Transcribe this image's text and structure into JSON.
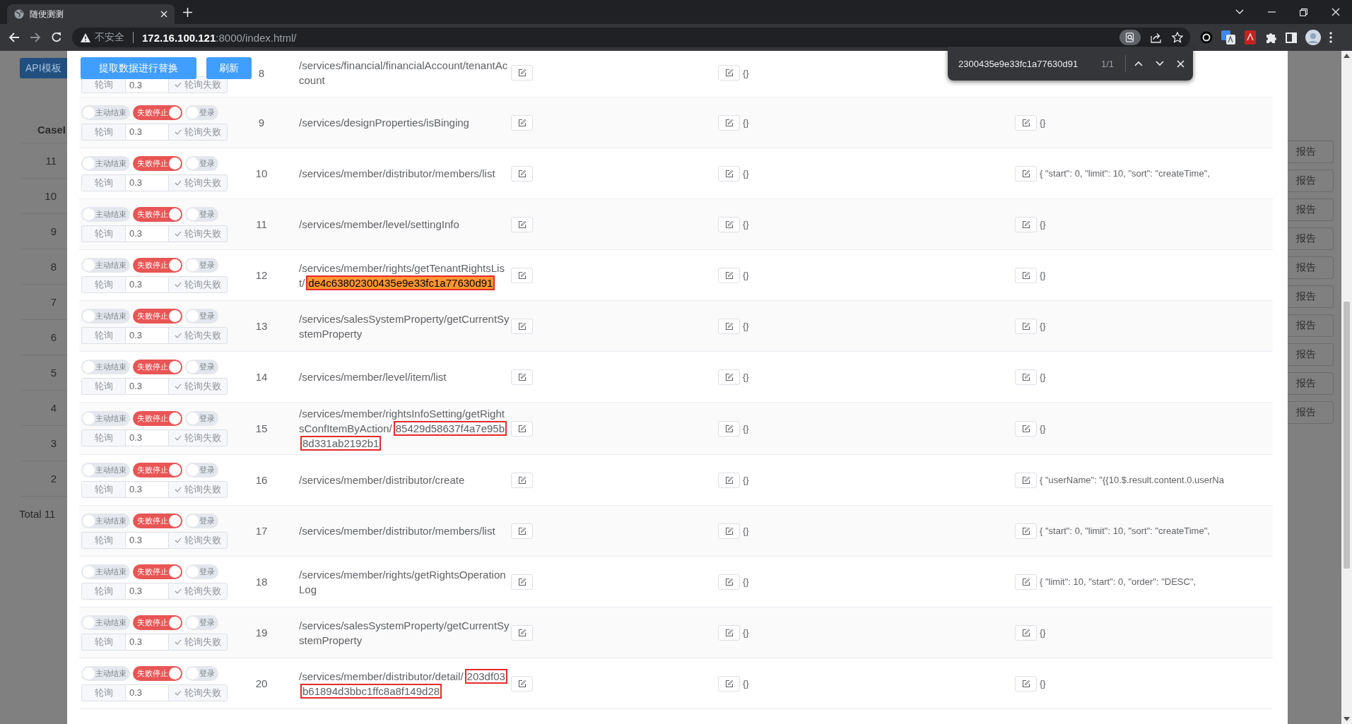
{
  "browser": {
    "tab": {
      "title": "随便测测"
    },
    "address": {
      "security": "不安全",
      "host": "172.16.100.121",
      "rest": ":8000/index.html/"
    }
  },
  "find_bar": {
    "query": "2300435e9e33fc1a77630d91",
    "count": "1/1"
  },
  "background": {
    "button": "API模板",
    "column": "CaseI",
    "case_ids": [
      "11",
      "10",
      "9",
      "8",
      "7",
      "6",
      "5",
      "4",
      "3",
      "2"
    ],
    "report_buttons": [
      "报告",
      "报告",
      "报告",
      "报告",
      "报告",
      "报告",
      "报告",
      "报告",
      "报告",
      "报告"
    ],
    "total": "Total 11"
  },
  "dialog": {
    "buttons": [
      "提取数据进行替换",
      "刷新"
    ],
    "rows": [
      {
        "index": "8",
        "poll": {
          "prefix": "轮询",
          "value": "0.3",
          "suffix": "轮询失败"
        },
        "path": [
          {
            "text": "/services/financial/financialAccount/tenantAccount",
            "highlight": false,
            "boxed": false
          }
        ],
        "column_5": "{}"
      },
      {
        "index": "9",
        "toggles": [
          {
            "label": "主动结束",
            "on": false
          },
          {
            "label": "失败停止",
            "on": true
          },
          {
            "label": "登录",
            "on": false
          }
        ],
        "poll": {
          "prefix": "轮询",
          "value": "0.3",
          "suffix": "轮询失败"
        },
        "path": [
          {
            "text": "/services/designProperties/isBinging",
            "highlight": false,
            "boxed": false
          }
        ],
        "column_5": "{}",
        "column_6": "{}"
      },
      {
        "index": "10",
        "toggles": [
          {
            "label": "主动结束",
            "on": false
          },
          {
            "label": "失败停止",
            "on": true
          },
          {
            "label": "登录",
            "on": false
          }
        ],
        "poll": {
          "prefix": "轮询",
          "value": "0.3",
          "suffix": "轮询失败"
        },
        "path": [
          {
            "text": "/services/member/distributor/members/list",
            "highlight": false,
            "boxed": false
          }
        ],
        "column_5": "{}",
        "column_6": "{ \"start\": 0, \"limit\": 10, \"sort\": \"createTime\","
      },
      {
        "index": "11",
        "toggles": [
          {
            "label": "主动结束",
            "on": false
          },
          {
            "label": "失败停止",
            "on": true
          },
          {
            "label": "登录",
            "on": false
          }
        ],
        "poll": {
          "prefix": "轮询",
          "value": "0.3",
          "suffix": "轮询失败"
        },
        "path": [
          {
            "text": "/services/member/level/settingInfo",
            "highlight": false,
            "boxed": false
          }
        ],
        "column_5": "{}",
        "column_6": "{}"
      },
      {
        "index": "12",
        "toggles": [
          {
            "label": "主动结束",
            "on": false
          },
          {
            "label": "失败停止",
            "on": true
          },
          {
            "label": "登录",
            "on": false
          }
        ],
        "poll": {
          "prefix": "轮询",
          "value": "0.3",
          "suffix": "轮询失败"
        },
        "path": [
          {
            "text": "/services/member/rights/getTenantRightsList/",
            "highlight": false,
            "boxed": false
          },
          {
            "text": "de4c63802300435e9e33fc1a77630d91",
            "highlight": true,
            "boxed": true
          }
        ],
        "column_5": "{}",
        "column_6": "{}"
      },
      {
        "index": "13",
        "toggles": [
          {
            "label": "主动结束",
            "on": false
          },
          {
            "label": "失败停止",
            "on": true
          },
          {
            "label": "登录",
            "on": false
          }
        ],
        "poll": {
          "prefix": "轮询",
          "value": "0.3",
          "suffix": "轮询失败"
        },
        "path": [
          {
            "text": "/services/salesSystemProperty/getCurrentSystemProperty",
            "highlight": false,
            "boxed": false
          }
        ],
        "column_5": "{}",
        "column_6": "{}"
      },
      {
        "index": "14",
        "toggles": [
          {
            "label": "主动结束",
            "on": false
          },
          {
            "label": "失败停止",
            "on": true
          },
          {
            "label": "登录",
            "on": false
          }
        ],
        "poll": {
          "prefix": "轮询",
          "value": "0.3",
          "suffix": "轮询失败"
        },
        "path": [
          {
            "text": "/services/member/level/item/list",
            "highlight": false,
            "boxed": false
          }
        ],
        "column_5": "{}",
        "column_6": "{}"
      },
      {
        "index": "15",
        "toggles": [
          {
            "label": "主动结束",
            "on": false
          },
          {
            "label": "失败停止",
            "on": true
          },
          {
            "label": "登录",
            "on": false
          }
        ],
        "poll": {
          "prefix": "轮询",
          "value": "0.3",
          "suffix": "轮询失败"
        },
        "path": [
          {
            "text": "/services/member/rightsInfoSetting/getRightsConfItemByAction/",
            "highlight": false,
            "boxed": false
          },
          {
            "text": "85429d58637f4a7e95b8d331ab2192b1",
            "highlight": false,
            "boxed": true
          }
        ],
        "column_5": "{}",
        "column_6": "{}"
      },
      {
        "index": "16",
        "toggles": [
          {
            "label": "主动结束",
            "on": false
          },
          {
            "label": "失败停止",
            "on": true
          },
          {
            "label": "登录",
            "on": false
          }
        ],
        "poll": {
          "prefix": "轮询",
          "value": "0.3",
          "suffix": "轮询失败"
        },
        "path": [
          {
            "text": "/services/member/distributor/create",
            "highlight": false,
            "boxed": false
          }
        ],
        "column_5": "{}",
        "column_6": "{ \"userName\": \"{{10.$.result.content.0.userNa"
      },
      {
        "index": "17",
        "toggles": [
          {
            "label": "主动结束",
            "on": false
          },
          {
            "label": "失败停止",
            "on": true
          },
          {
            "label": "登录",
            "on": false
          }
        ],
        "poll": {
          "prefix": "轮询",
          "value": "0.3",
          "suffix": "轮询失败"
        },
        "path": [
          {
            "text": "/services/member/distributor/members/list",
            "highlight": false,
            "boxed": false
          }
        ],
        "column_5": "{}",
        "column_6": "{ \"start\": 0, \"limit\": 10, \"sort\": \"createTime\","
      },
      {
        "index": "18",
        "toggles": [
          {
            "label": "主动结束",
            "on": false
          },
          {
            "label": "失败停止",
            "on": true
          },
          {
            "label": "登录",
            "on": false
          }
        ],
        "poll": {
          "prefix": "轮询",
          "value": "0.3",
          "suffix": "轮询失败"
        },
        "path": [
          {
            "text": "/services/member/rights/getRightsOperationLog",
            "highlight": false,
            "boxed": false
          }
        ],
        "column_5": "{}",
        "column_6": "{ \"limit\": 10, \"start\": 0, \"order\": \"DESC\","
      },
      {
        "index": "19",
        "toggles": [
          {
            "label": "主动结束",
            "on": false
          },
          {
            "label": "失败停止",
            "on": true
          },
          {
            "label": "登录",
            "on": false
          }
        ],
        "poll": {
          "prefix": "轮询",
          "value": "0.3",
          "suffix": "轮询失败"
        },
        "path": [
          {
            "text": "/services/salesSystemProperty/getCurrentSystemProperty",
            "highlight": false,
            "boxed": false
          }
        ],
        "column_5": "{}",
        "column_6": "{}"
      },
      {
        "index": "20",
        "toggles": [
          {
            "label": "主动结束",
            "on": false
          },
          {
            "label": "失败停止",
            "on": true
          },
          {
            "label": "登录",
            "on": false
          }
        ],
        "poll": {
          "prefix": "轮询",
          "value": "0.3",
          "suffix": "轮询失败"
        },
        "path": [
          {
            "text": "/services/member/distributor/detail/",
            "highlight": false,
            "boxed": false
          },
          {
            "text": "203df03b61894d3bbc1ffc8a8f149d28",
            "highlight": false,
            "boxed": true
          }
        ],
        "column_5": "{}",
        "column_6": "{}"
      }
    ]
  }
}
